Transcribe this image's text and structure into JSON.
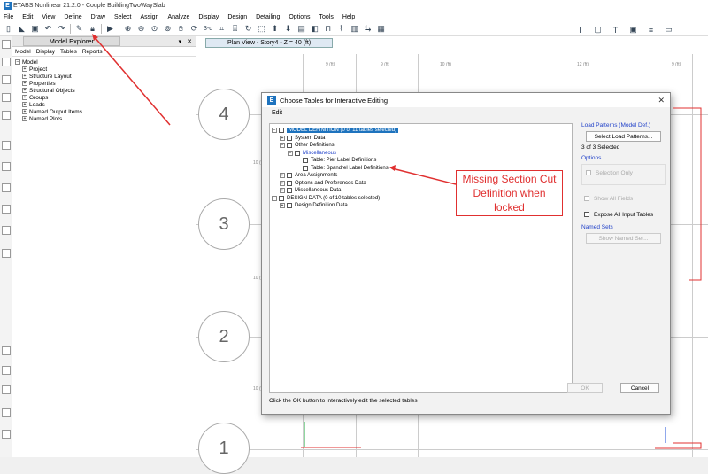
{
  "app": {
    "title": "ETABS Nonlinear 21.2.0 - Couple BuildingTwoWaySlab",
    "logo_letter": "E"
  },
  "menu": [
    "File",
    "Edit",
    "View",
    "Define",
    "Draw",
    "Select",
    "Assign",
    "Analyze",
    "Display",
    "Design",
    "Detailing",
    "Options",
    "Tools",
    "Help"
  ],
  "toolbar": {
    "view_3d_label": "3-d",
    "icons": [
      "new-icon",
      "open-icon",
      "save-icon",
      "undo-icon",
      "redo-icon",
      "pencil-icon",
      "lock-icon",
      "run-icon",
      "zoom-in-icon",
      "zoom-out-icon",
      "zoom-window-icon",
      "zoom-fit-icon",
      "pan-icon",
      "refresh-icon"
    ]
  },
  "explorer": {
    "title": "Model Explorer",
    "pin": "▾",
    "close": "✕",
    "tabs": [
      "Model",
      "Display",
      "Tables",
      "Reports"
    ],
    "root": "Model",
    "items": [
      "Project",
      "Structure Layout",
      "Properties",
      "Structural Objects",
      "Groups",
      "Loads",
      "Named Output Items",
      "Named Plots"
    ]
  },
  "view": {
    "tab_title": "Plan View - Story4 - Z = 40 (ft)",
    "gridlines": [
      "4",
      "3",
      "2",
      "1"
    ],
    "dims": [
      "9 (ft)",
      "9 (ft)",
      "10 (ft)",
      "12 (ft)",
      "9 (ft)"
    ],
    "side_dims": [
      "10 (ft)",
      "10 (ft)",
      "10 (ft)"
    ]
  },
  "dialog": {
    "title": "Choose Tables for Interactive Editing",
    "icon_letter": "E",
    "close": "✕",
    "menu": "Edit",
    "tree": [
      {
        "text": "MODEL DEFINITION  (0 of 11 tables selected)",
        "level": 0,
        "exp": "-",
        "style": "highlight"
      },
      {
        "text": "System Data",
        "level": 1,
        "exp": "+",
        "style": ""
      },
      {
        "text": "Other Definitions",
        "level": 1,
        "exp": "-",
        "style": ""
      },
      {
        "text": "Miscellaneous",
        "level": 2,
        "exp": "-",
        "style": "blue"
      },
      {
        "text": "Table:  Pier Label Definitions",
        "level": 3,
        "exp": "",
        "style": ""
      },
      {
        "text": "Table:  Spandrel Label Definitions",
        "level": 3,
        "exp": "",
        "style": ""
      },
      {
        "text": "Area Assignments",
        "level": 1,
        "exp": "+",
        "style": ""
      },
      {
        "text": "Options and Preferences Data",
        "level": 1,
        "exp": "+",
        "style": ""
      },
      {
        "text": "Miscellaneous Data",
        "level": 1,
        "exp": "+",
        "style": ""
      },
      {
        "text": "DESIGN DATA  (0 of 10 tables selected)",
        "level": 0,
        "exp": "-",
        "style": ""
      },
      {
        "text": "Design Definition Data",
        "level": 1,
        "exp": "+",
        "style": ""
      }
    ],
    "footer": "Click the OK button to interactively edit the selected tables",
    "load_patterns_heading": "Load Patterns (Model Def.)",
    "select_load_patterns": "Select Load Patterns...",
    "selected_count": "3 of 3 Selected",
    "options_heading": "Options",
    "selection_only": "Selection Only",
    "show_all_fields": "Show All Fields",
    "expose_all": "Expose All Input Tables",
    "named_sets_heading": "Named Sets",
    "show_named_set": "Show Named Set...",
    "ok": "OK",
    "cancel": "Cancel"
  },
  "annotation": "Missing Section Cut Definition when locked",
  "colors": {
    "annotation": "#e03030",
    "highlight": "#1e73be",
    "frame_red": "#e03030"
  }
}
